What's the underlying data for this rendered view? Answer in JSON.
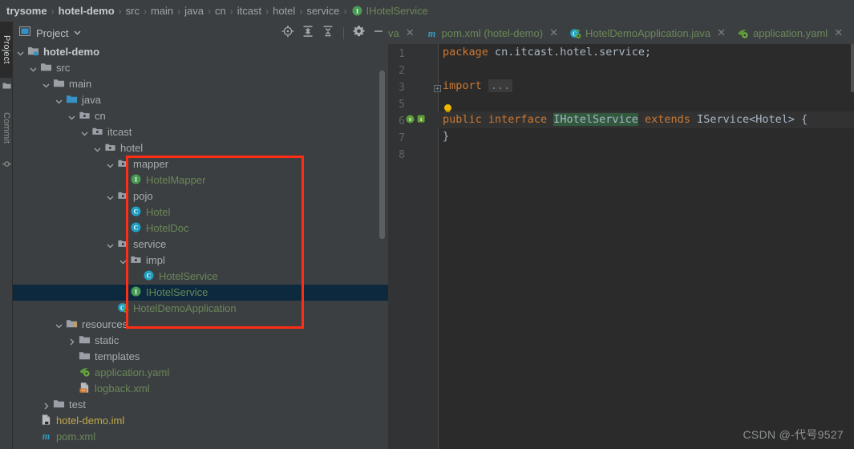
{
  "breadcrumb": {
    "items": [
      {
        "label": "trysome",
        "style": "bold"
      },
      {
        "label": "hotel-demo",
        "style": "bold"
      },
      {
        "label": "src",
        "style": "plain"
      },
      {
        "label": "main",
        "style": "plain"
      },
      {
        "label": "java",
        "style": "plain"
      },
      {
        "label": "cn",
        "style": "plain"
      },
      {
        "label": "itcast",
        "style": "plain"
      },
      {
        "label": "hotel",
        "style": "plain"
      },
      {
        "label": "service",
        "style": "plain"
      },
      {
        "label": "IHotelService",
        "style": "leaf",
        "icon": "interface-icon"
      }
    ],
    "separator": "›"
  },
  "toolstrip": {
    "tabs": [
      {
        "label": "Project",
        "active": true,
        "icon": "project-panel-icon"
      },
      {
        "label": "Commit",
        "active": false,
        "icon": "commit-icon"
      }
    ]
  },
  "panel": {
    "title": "Project",
    "dropdown_icon": "chevron-down-icon",
    "view_icon": "project-view-icon",
    "tools": [
      {
        "name": "locate-icon",
        "title": "Select Opened File"
      },
      {
        "name": "expand-all-icon",
        "title": "Expand All"
      },
      {
        "name": "collapse-all-icon",
        "title": "Collapse All"
      },
      {
        "name": "gear-icon",
        "title": "Settings"
      },
      {
        "name": "minimize-icon",
        "title": "Hide"
      }
    ]
  },
  "tree": {
    "rows": [
      {
        "label": "hotel-demo",
        "depth": 1,
        "arrow": "down",
        "icon": "module-icon",
        "color": "c-mod",
        "selected": false
      },
      {
        "label": "src",
        "depth": 2,
        "arrow": "down",
        "icon": "folder-icon",
        "color": "c-dir",
        "selected": false
      },
      {
        "label": "main",
        "depth": 3,
        "arrow": "down",
        "icon": "folder-icon",
        "color": "c-dir",
        "selected": false
      },
      {
        "label": "java",
        "depth": 4,
        "arrow": "down",
        "icon": "source-root-icon",
        "color": "c-dir",
        "selected": false
      },
      {
        "label": "cn",
        "depth": 5,
        "arrow": "down",
        "icon": "package-icon",
        "color": "c-dir",
        "selected": false
      },
      {
        "label": "itcast",
        "depth": 6,
        "arrow": "down",
        "icon": "package-icon",
        "color": "c-dir",
        "selected": false
      },
      {
        "label": "hotel",
        "depth": 7,
        "arrow": "down",
        "icon": "package-icon",
        "color": "c-dir",
        "selected": false
      },
      {
        "label": "mapper",
        "depth": 8,
        "arrow": "down",
        "icon": "package-icon",
        "color": "c-dir",
        "selected": false
      },
      {
        "label": "HotelMapper",
        "depth": 9,
        "arrow": "none",
        "icon": "interface-icon",
        "color": "c-green",
        "selected": false
      },
      {
        "label": "pojo",
        "depth": 8,
        "arrow": "down",
        "icon": "package-icon",
        "color": "c-dir",
        "selected": false
      },
      {
        "label": "Hotel",
        "depth": 9,
        "arrow": "none",
        "icon": "class-icon",
        "color": "c-green",
        "selected": false
      },
      {
        "label": "HotelDoc",
        "depth": 9,
        "arrow": "none",
        "icon": "class-icon",
        "color": "c-green",
        "selected": false
      },
      {
        "label": "service",
        "depth": 8,
        "arrow": "down",
        "icon": "package-icon",
        "color": "c-dir",
        "selected": false
      },
      {
        "label": "impl",
        "depth": 9,
        "arrow": "down",
        "icon": "package-icon",
        "color": "c-dir",
        "selected": false
      },
      {
        "label": "HotelService",
        "depth": 10,
        "arrow": "none",
        "icon": "class-icon",
        "color": "c-green",
        "selected": false
      },
      {
        "label": "IHotelService",
        "depth": 9,
        "arrow": "none",
        "icon": "interface-icon",
        "color": "c-green",
        "selected": true
      },
      {
        "label": "HotelDemoApplication",
        "depth": 8,
        "arrow": "none",
        "icon": "spring-app-icon",
        "color": "c-green",
        "selected": false
      },
      {
        "label": "resources",
        "depth": 4,
        "arrow": "down",
        "icon": "resource-root-icon",
        "color": "c-dir",
        "selected": false
      },
      {
        "label": "static",
        "depth": 5,
        "arrow": "right",
        "icon": "folder-icon",
        "color": "c-dir",
        "selected": false
      },
      {
        "label": "templates",
        "depth": 5,
        "arrow": "none",
        "icon": "folder-icon",
        "color": "c-dir",
        "selected": false
      },
      {
        "label": "application.yaml",
        "depth": 5,
        "arrow": "none",
        "icon": "yaml-icon",
        "color": "c-green",
        "selected": false
      },
      {
        "label": "logback.xml",
        "depth": 5,
        "arrow": "none",
        "icon": "xml-icon",
        "color": "c-green",
        "selected": false
      },
      {
        "label": "test",
        "depth": 3,
        "arrow": "right",
        "icon": "folder-icon",
        "color": "c-dir",
        "selected": false
      },
      {
        "label": "hotel-demo.iml",
        "depth": 2,
        "arrow": "none",
        "icon": "iml-icon",
        "color": "c-yellow",
        "selected": false
      },
      {
        "label": "pom.xml",
        "depth": 2,
        "arrow": "none",
        "icon": "maven-icon",
        "color": "c-green",
        "selected": false
      }
    ]
  },
  "editor_tabs": [
    {
      "label": "va",
      "icon": "java-icon",
      "truncated": true
    },
    {
      "label": "pom.xml (hotel-demo)",
      "icon": "maven-icon"
    },
    {
      "label": "HotelDemoApplication.java",
      "icon": "spring-app-icon"
    },
    {
      "label": "application.yaml",
      "icon": "yaml-icon"
    },
    {
      "label": "",
      "icon": "interface-icon",
      "truncated": true
    }
  ],
  "editor": {
    "line_numbers": [
      "1",
      "2",
      "3",
      "5",
      "6",
      "7",
      "8"
    ],
    "lines": [
      {
        "type": "package",
        "keyword": "package",
        "value": " cn.itcast.hotel.service;"
      },
      {
        "type": "blank",
        "value": ""
      },
      {
        "type": "import",
        "keyword": "import",
        "fold": "..."
      },
      {
        "type": "bulb",
        "value": ""
      },
      {
        "type": "decl",
        "kw1": "public",
        "kw2": "interface",
        "name": "IHotelService",
        "kw3": "extends",
        "tail": "IService<Hotel> {"
      },
      {
        "type": "close",
        "value": "}"
      },
      {
        "type": "blank",
        "value": ""
      }
    ],
    "gutter_icons": [
      "spring-bean-icon",
      "implementation-icon"
    ]
  },
  "watermark": "CSDN @-代号9527",
  "colors": {
    "background": "#3c3f41",
    "editor_background": "#2b2b2b",
    "selection": "#0d293e",
    "annotation": "#ff2d16",
    "keyword": "#cc7832",
    "green_text": "#6a8759",
    "interface_icon": "#499c54",
    "class_icon": "#20a0c0"
  }
}
